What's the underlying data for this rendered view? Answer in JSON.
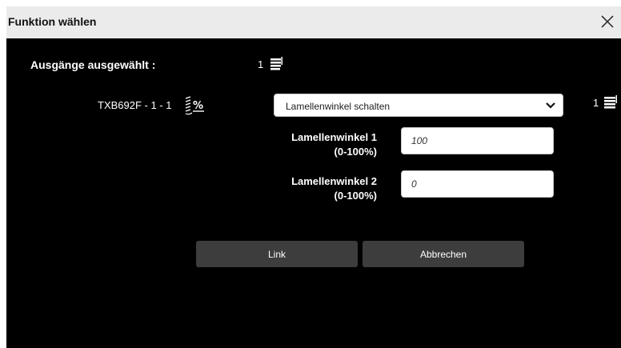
{
  "dialog": {
    "title": "Funktion wählen",
    "close_label": "×"
  },
  "outputs": {
    "selected_label": "Ausgänge ausgewählt :",
    "selected_count": "1"
  },
  "device": {
    "name": "TXB692F - 1 - 1",
    "count": "1"
  },
  "function_select": {
    "value": "Lamellenwinkel schalten"
  },
  "fields": [
    {
      "label_line1": "Lamellenwinkel 1",
      "label_line2": "(0-100%)",
      "value": "100"
    },
    {
      "label_line1": "Lamellenwinkel 2",
      "label_line2": "(0-100%)",
      "value": "0"
    }
  ],
  "buttons": {
    "link": "Link",
    "cancel": "Abbrechen"
  },
  "colors": {
    "background": "#000000",
    "titlebar": "#ebebeb",
    "button": "#3d3d3d"
  }
}
